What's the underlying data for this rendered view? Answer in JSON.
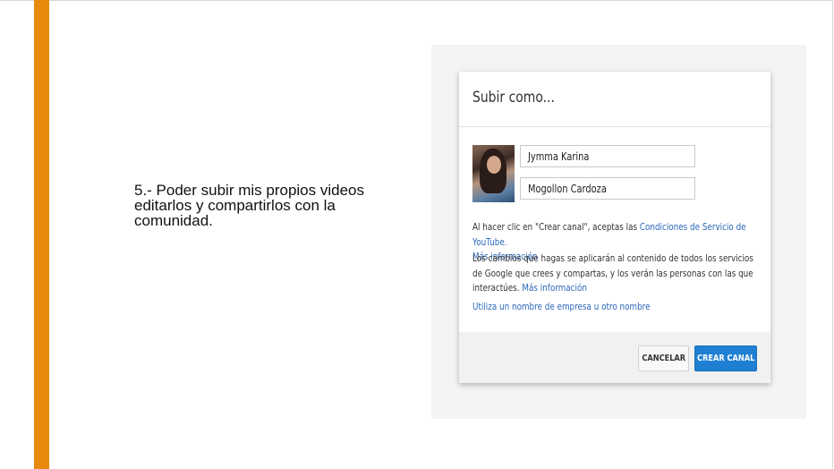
{
  "slide": {
    "text": "5.- Poder subir mis propios videos editarlos y compartirlos con la comunidad.",
    "accent_color": "#e8890c"
  },
  "dialog": {
    "title": "Subir como...",
    "first_name": "Jymma Karina",
    "last_name": "Mogollon Cardoza",
    "terms_prefix": "Al hacer clic en \"Crear canal\", aceptas las ",
    "terms_link": "Condiciones de Servicio de YouTube.",
    "more_info_1": "Más información",
    "changes_text": "Los cambios que hagas se aplicarán al contenido de todos los servicios de Google que crees y compartas, y los verán las personas con las que interactúes. ",
    "more_info_2": "Más información",
    "business_link": "Utiliza un nombre de empresa u otro nombre",
    "cancel_label": "CANCELAR",
    "create_label": "CREAR CANAL",
    "create_color": "#1f7fd2"
  }
}
